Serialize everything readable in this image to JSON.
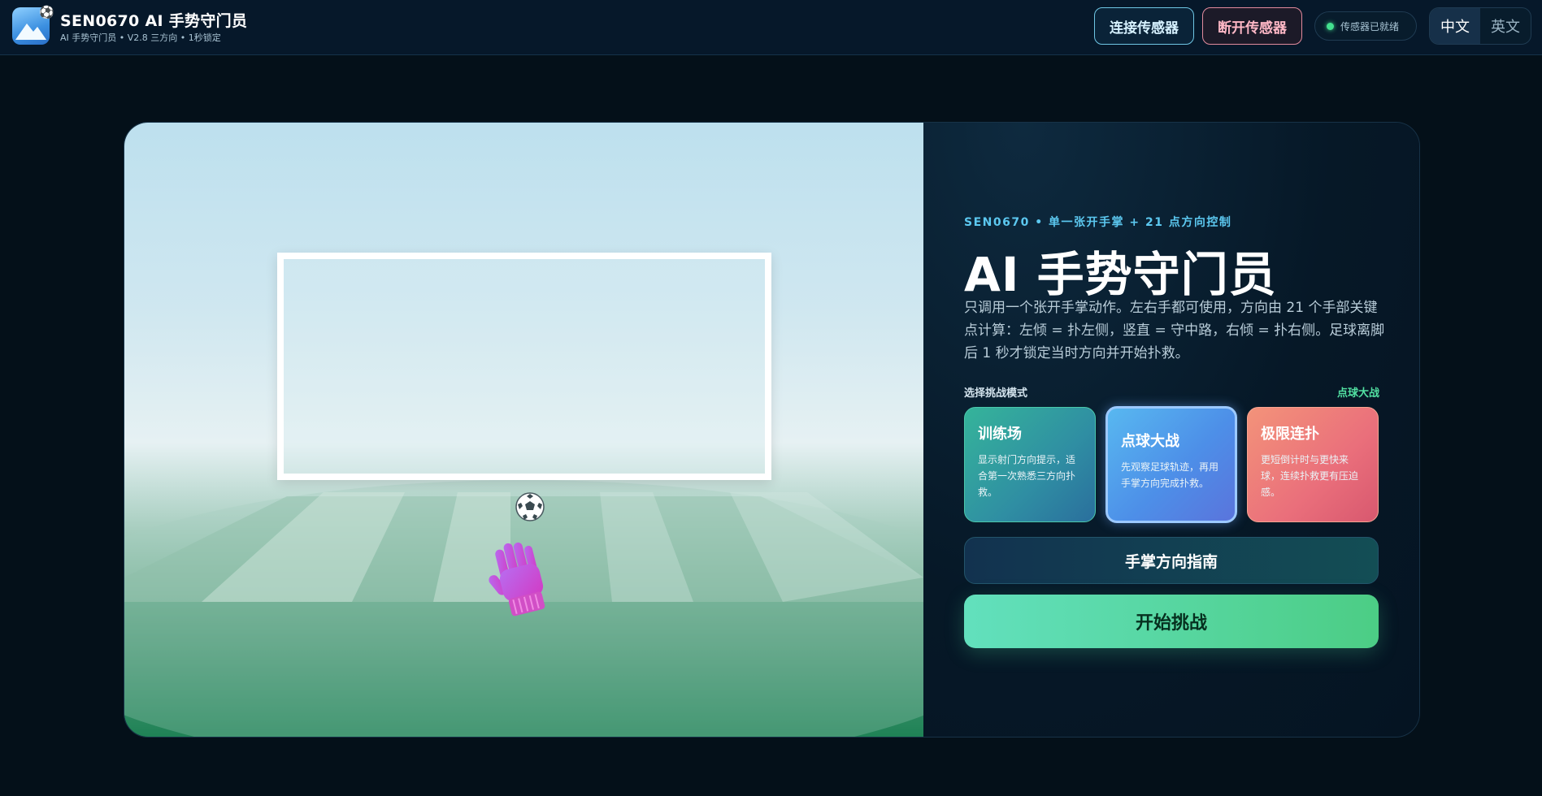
{
  "header": {
    "title": "SEN0670 AI 手势守门员",
    "subtitle": "AI 手势守门员 • V2.8 三方向 • 1秒锁定",
    "logo_icon": "mountain-logo-icon",
    "logo_badge_icon": "soccer-ball-icon",
    "connect_label": "连接传感器",
    "disconnect_label": "断开传感器",
    "sensor_status": "传感器已就绪",
    "languages": [
      "中文",
      "英文"
    ],
    "active_language": "中文"
  },
  "scene": {
    "goal": "soccer-goal",
    "ball_icon": "soccer-ball-icon",
    "glove_icon": "goalkeeper-glove-icon"
  },
  "info": {
    "eyebrow": "SEN0670 • 单一张开手掌 + 21 点方向控制",
    "title": "AI 手势守门员",
    "description": "只调用一个张开手掌动作。左右手都可使用，方向由 21 个手部关键点计算：左倾 = 扑左侧，竖直 = 守中路，右倾 = 扑右侧。足球离脚后 1 秒才锁定当时方向并开始扑救。",
    "mode_label": "选择挑战模式",
    "current_mode": "点球大战",
    "modes": [
      {
        "title": "训练场",
        "desc": "显示射门方向提示，适合第一次熟悉三方向扑救。"
      },
      {
        "title": "点球大战",
        "desc": "先观察足球轨迹，再用手掌方向完成扑救。"
      },
      {
        "title": "极限连扑",
        "desc": "更短倒计时与更快来球，连续扑救更有压迫感。"
      }
    ],
    "guide_label": "手掌方向指南",
    "start_label": "开始挑战"
  },
  "colors": {
    "accent": "#5cc8f0",
    "success": "#43e08f",
    "danger": "#e28a9d",
    "start": "#4ccd85"
  }
}
